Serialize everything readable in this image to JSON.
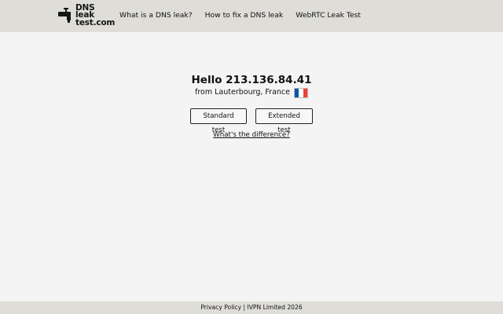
{
  "header": {
    "logo": {
      "line1": "DNS leak",
      "line2": "test.com",
      "icon": "faucet-icon"
    },
    "nav": [
      {
        "label": "What is a DNS leak?"
      },
      {
        "label": "How to fix a DNS leak"
      },
      {
        "label": "WebRTC Leak Test"
      }
    ]
  },
  "main": {
    "greeting": "Hello 213.136.84.41",
    "location": "from Lauterbourg, France",
    "flag": {
      "icon": "france-flag-icon",
      "colors": [
        "#0055a4",
        "#ffffff",
        "#ef4135"
      ]
    },
    "buttons": {
      "standard": "Standard test",
      "extended": "Extended test"
    },
    "difference_link": "What's the difference?"
  },
  "footer": {
    "privacy": "Privacy Policy",
    "separator": " | ",
    "company": "IVPN Limited 2026"
  },
  "colors": {
    "header_bg": "#deddd8",
    "page_bg": "#f4f4f4",
    "text": "#111111"
  }
}
